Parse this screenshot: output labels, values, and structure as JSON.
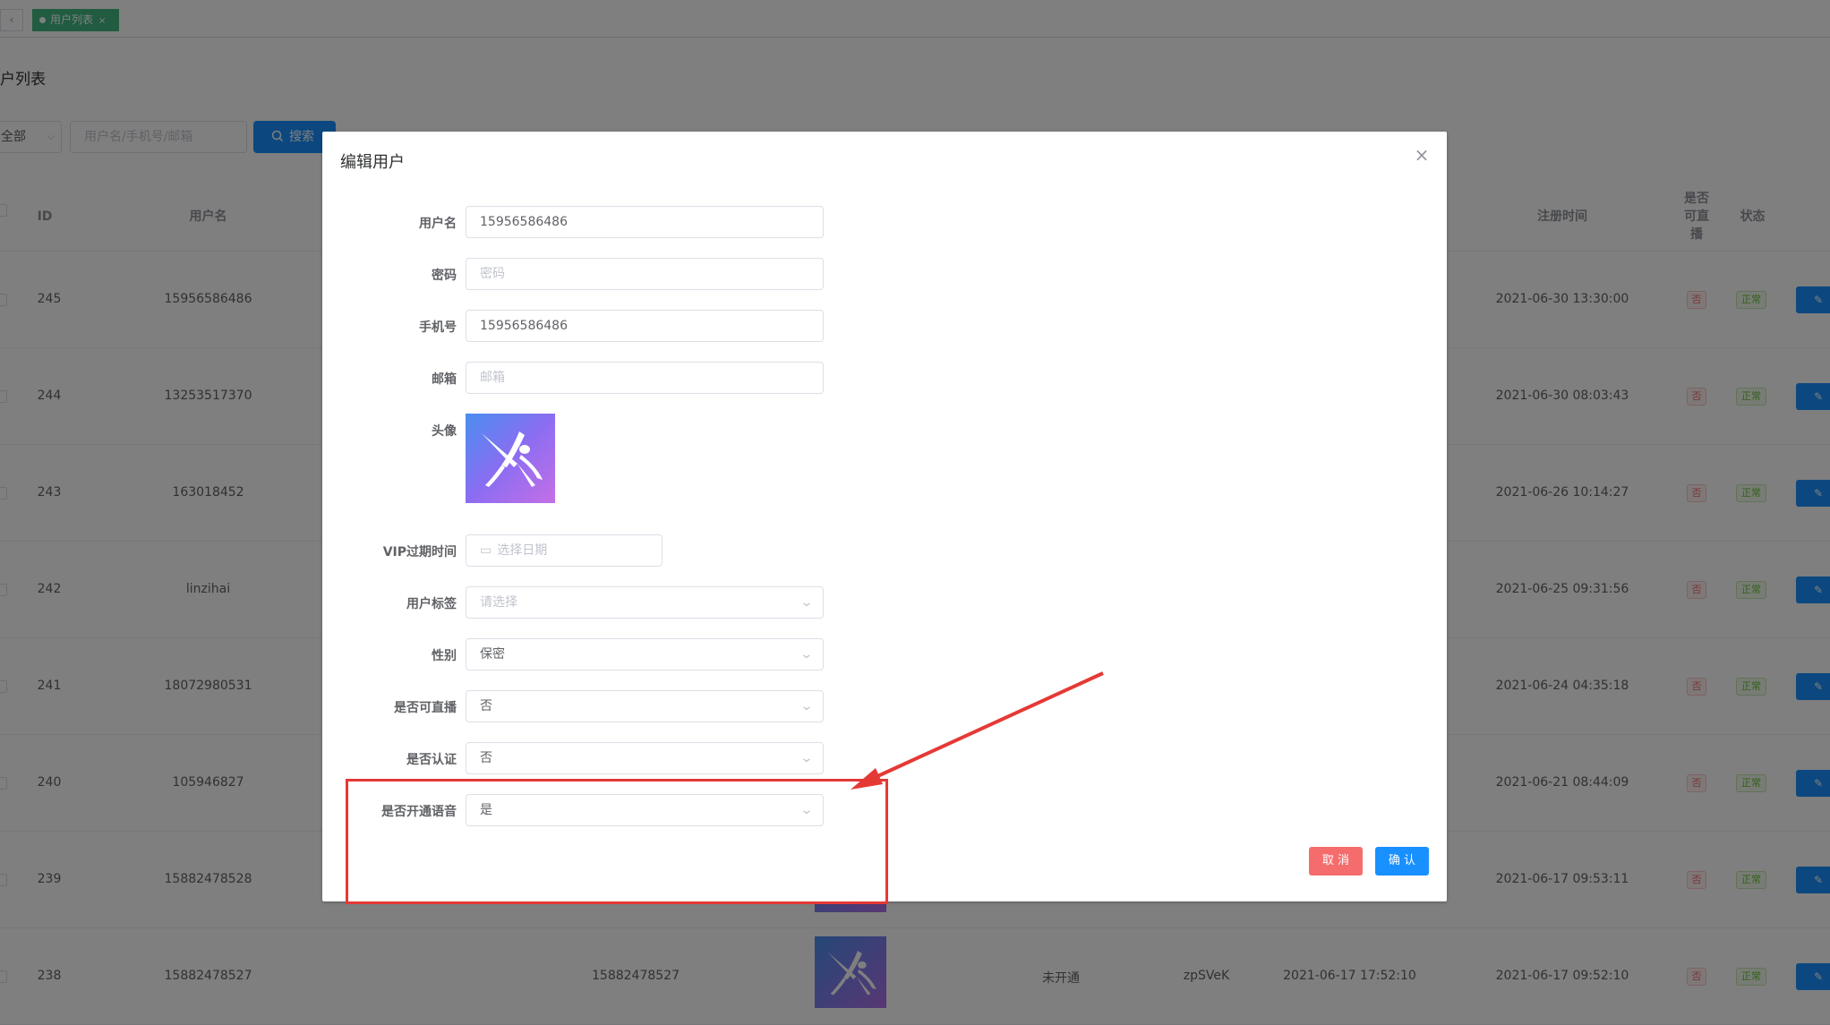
{
  "tabbar": {
    "back_label": "‹",
    "active_tab": "用户列表",
    "close": "×"
  },
  "page": {
    "title": "户列表"
  },
  "filter": {
    "type_value": "全部",
    "search_placeholder": "用户名/手机号/邮箱",
    "search_button": "搜索"
  },
  "table": {
    "headers": {
      "id": "ID",
      "username": "用户名",
      "reg_time": "注册时间",
      "can_live": "是否可直播",
      "status": "状态"
    },
    "rows": [
      {
        "id": "245",
        "username": "15956586486",
        "reg_time": "2021-06-30 13:30:00",
        "can_live": "否",
        "status": "正常"
      },
      {
        "id": "244",
        "username": "13253517370",
        "reg_time": "2021-06-30 08:03:43",
        "can_live": "否",
        "status": "正常"
      },
      {
        "id": "243",
        "username": "163018452",
        "reg_time": "2021-06-26 10:14:27",
        "can_live": "否",
        "status": "正常"
      },
      {
        "id": "242",
        "username": "linzihai",
        "reg_time": "2021-06-25 09:31:56",
        "can_live": "否",
        "status": "正常"
      },
      {
        "id": "241",
        "username": "18072980531",
        "reg_time": "2021-06-24 04:35:18",
        "can_live": "否",
        "status": "正常"
      },
      {
        "id": "240",
        "username": "105946827",
        "reg_time": "2021-06-21 08:44:09",
        "can_live": "否",
        "status": "正常"
      },
      {
        "id": "239",
        "username": "15882478528",
        "reg_time": "2021-06-17 09:53:11",
        "can_live": "否",
        "status": "正常"
      },
      {
        "id": "238",
        "username": "15882478527",
        "phone": "15882478527",
        "voice": "未开通",
        "invite": "zpSVeK",
        "login_time": "2021-06-17 17:52:10",
        "reg_time": "2021-06-17 09:52:10",
        "can_live": "否",
        "status": "正常"
      }
    ]
  },
  "dialog": {
    "title": "编辑用户",
    "close": "×",
    "fields": {
      "username": {
        "label": "用户名",
        "value": "15956586486"
      },
      "password": {
        "label": "密码",
        "placeholder": "密码"
      },
      "phone": {
        "label": "手机号",
        "value": "15956586486"
      },
      "email": {
        "label": "邮箱",
        "placeholder": "邮箱"
      },
      "avatar": {
        "label": "头像"
      },
      "vip_expire": {
        "label": "VIP过期时间",
        "placeholder": "选择日期"
      },
      "tags": {
        "label": "用户标签",
        "placeholder": "请选择"
      },
      "gender": {
        "label": "性别",
        "value": "保密"
      },
      "can_live": {
        "label": "是否可直播",
        "value": "否"
      },
      "verified": {
        "label": "是否认证",
        "value": "否"
      },
      "voice": {
        "label": "是否开通语音",
        "value": "是"
      }
    },
    "cancel_label": "取 消",
    "confirm_label": "确 认"
  },
  "colors": {
    "primary": "#1890ff",
    "danger": "#f56c6c",
    "tab_green": "#42b983",
    "annotation_red": "#e53935"
  }
}
